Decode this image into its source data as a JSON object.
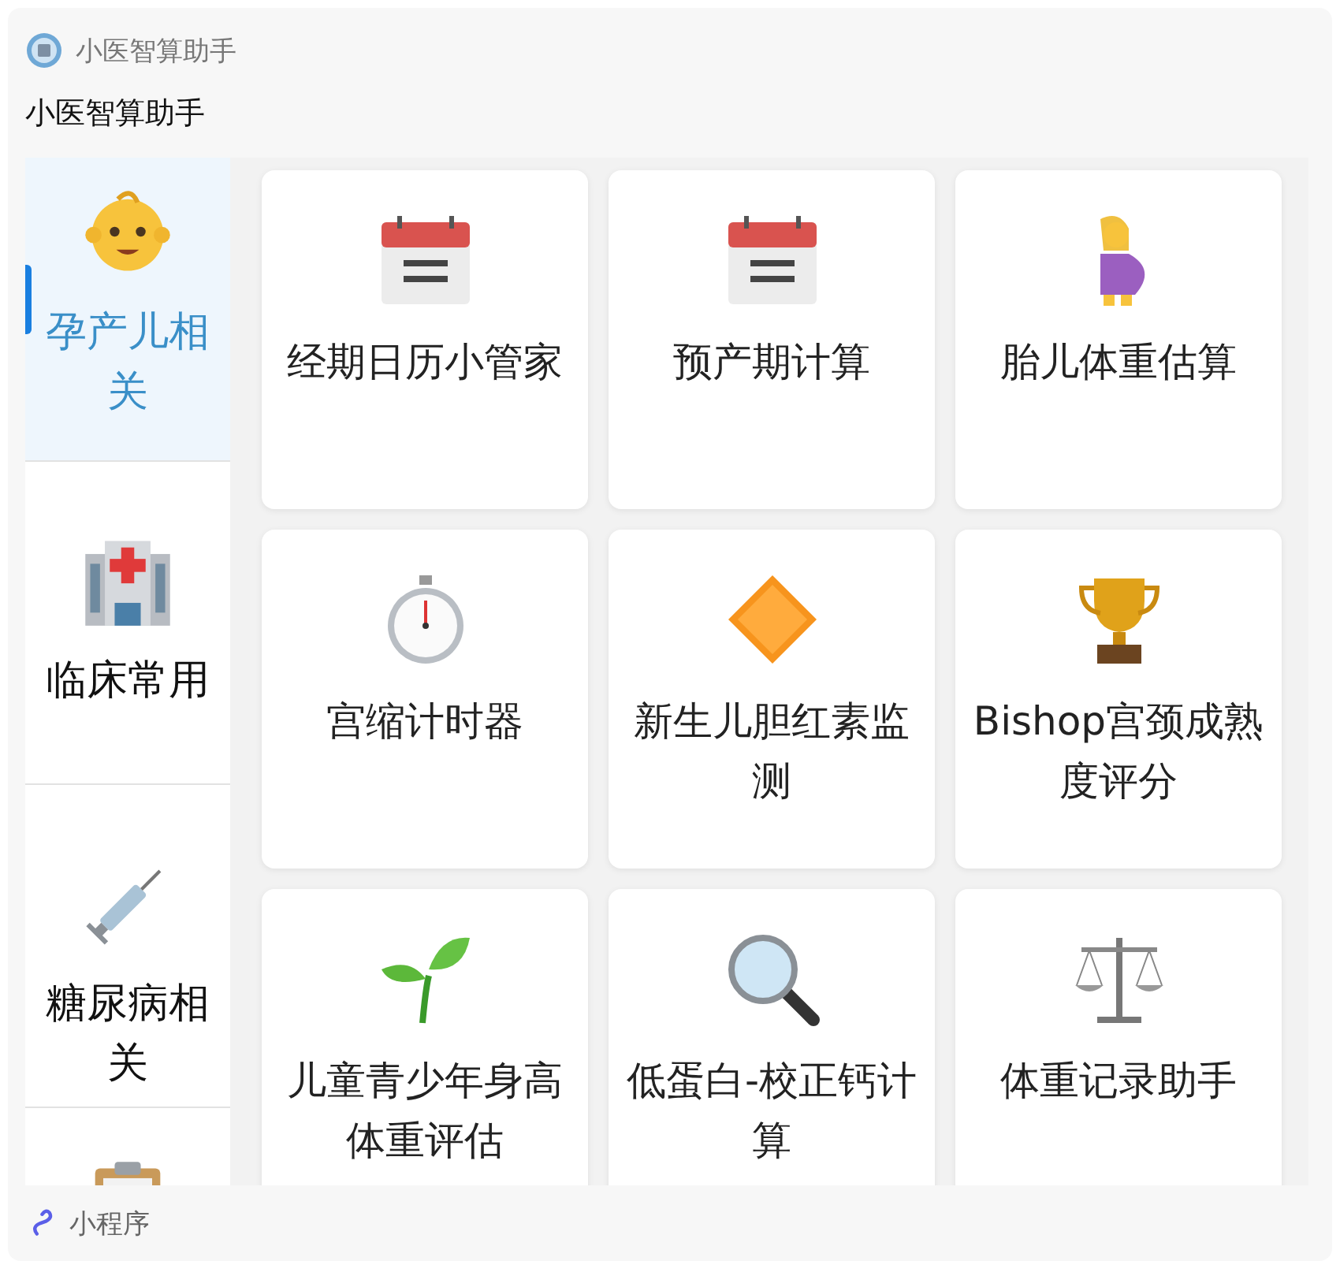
{
  "header": {
    "app_name": "小医智算助手",
    "title": "小医智算助手"
  },
  "sidebar": {
    "items": [
      {
        "label": "孕产儿相关",
        "selected": true
      },
      {
        "label": "临床常用",
        "selected": false
      },
      {
        "label": "糖尿病相关",
        "selected": false
      },
      {
        "selected": false
      }
    ]
  },
  "tools": [
    {
      "label": "经期日历小管家"
    },
    {
      "label": "预产期计算"
    },
    {
      "label": "胎儿体重估算"
    },
    {
      "label": "宫缩计时器"
    },
    {
      "label": "新生儿胆红素监测"
    },
    {
      "label": "Bishop宫颈成熟度评分"
    },
    {
      "label": "儿童青少年身高体重评估"
    },
    {
      "label": "低蛋白-校正钙计算"
    },
    {
      "label": "体重记录助手"
    }
  ],
  "footer": {
    "label": "小程序"
  }
}
